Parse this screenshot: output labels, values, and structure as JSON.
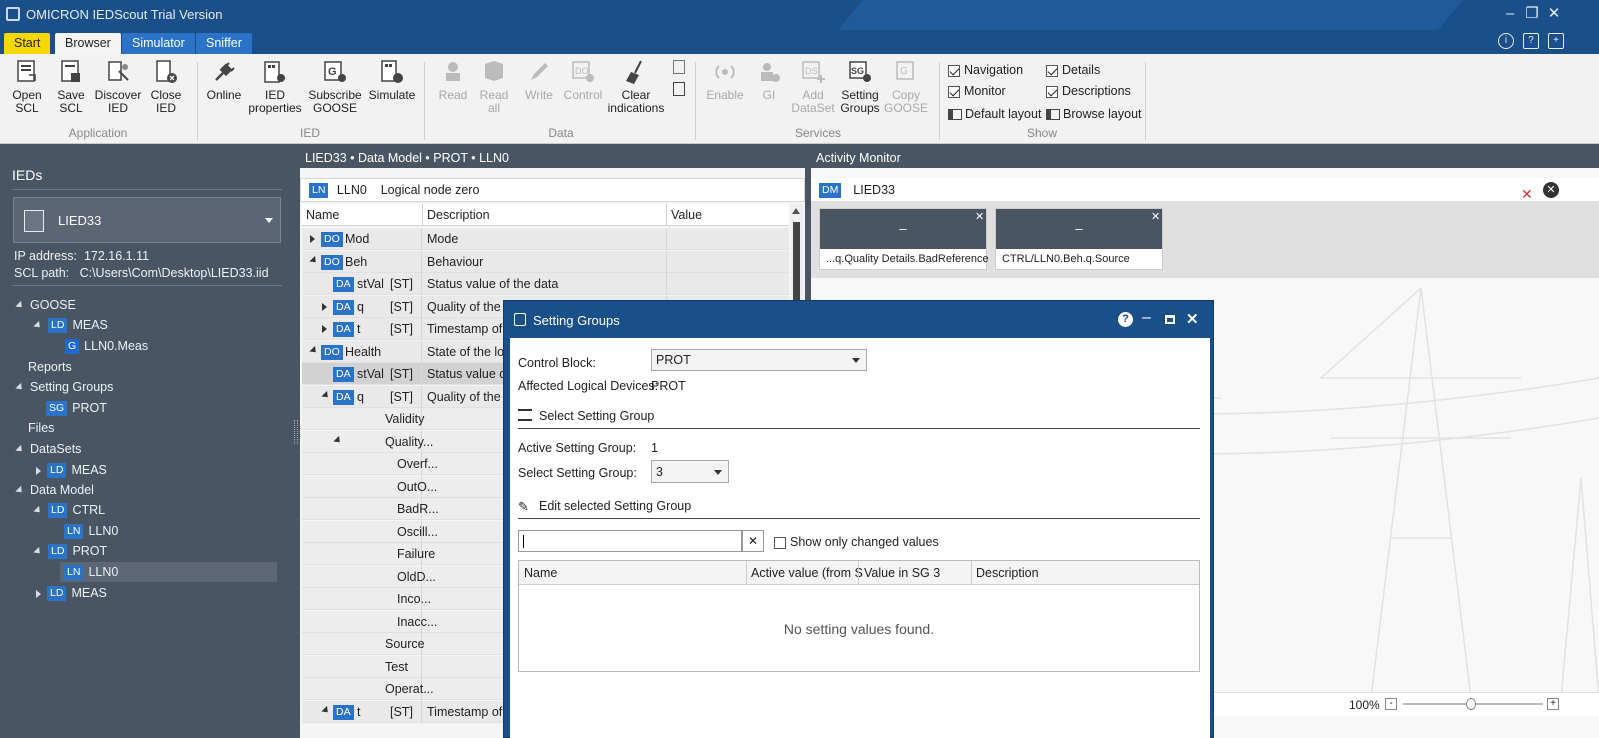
{
  "app": {
    "title": "OMICRON IEDScout Trial Version"
  },
  "tabs": [
    "Start",
    "Browser",
    "Simulator",
    "Sniffer"
  ],
  "ribbon": {
    "application": {
      "group_label": "Application",
      "open_scl": "Open\nSCL",
      "save_scl": "Save\nSCL",
      "discover_ied": "Discover\nIED",
      "close_ied": "Close\nIED"
    },
    "ied": {
      "group_label": "IED",
      "online": "Online",
      "ied_properties": "IED\nproperties",
      "subscribe_goose": "Subscribe\nGOOSE",
      "simulate": "Simulate"
    },
    "data": {
      "group_label": "Data",
      "read": "Read",
      "read_all": "Read\nall",
      "write": "Write",
      "control": "Control",
      "clear_indications": "Clear\nindications"
    },
    "services": {
      "group_label": "Services",
      "enable": "Enable",
      "gi": "GI",
      "add_dataset": "Add\nDataSet",
      "setting_groups": "Setting\nGroups",
      "copy_goose": "Copy\nGOOSE"
    },
    "show": {
      "group_label": "Show",
      "navigation": "Navigation",
      "details": "Details",
      "monitor": "Monitor",
      "descriptions": "Descriptions",
      "default_layout": "Default layout",
      "browse_layout": "Browse layout"
    }
  },
  "left": {
    "title": "IEDs",
    "ied_name": "LIED33",
    "ip_label": "IP address:",
    "ip_value": "172.16.1.11",
    "scl_label": "SCL path:",
    "scl_value": "C:\\Users\\Com\\Desktop\\LIED33.iid",
    "tree": {
      "goose": "GOOSE",
      "goose_ld": "MEAS",
      "goose_cb": "LLN0.Meas",
      "reports": "Reports",
      "setting_groups": "Setting Groups",
      "sg_prot": "PROT",
      "files": "Files",
      "datasets": "DataSets",
      "ds_meas": "MEAS",
      "data_model": "Data Model",
      "dm_ctrl": "CTRL",
      "dm_ctrl_lln0": "LLN0",
      "dm_prot": "PROT",
      "dm_prot_lln0": "LLN0",
      "dm_meas": "MEAS"
    },
    "badges": {
      "ld": "LD",
      "ln": "LN",
      "sg": "SG",
      "g": "G"
    }
  },
  "mid": {
    "header": "LIED33 • Data Model • PROT • LLN0",
    "ln_badge": "LN",
    "ln_name": "LLN0",
    "ln_desc": "Logical node zero",
    "col_name": "Name",
    "col_desc": "Description",
    "col_value": "Value",
    "rows": [
      {
        "badge": "DO",
        "name": "Mod",
        "fc": "",
        "desc": "Mode"
      },
      {
        "badge": "DO",
        "name": "Beh",
        "fc": "",
        "desc": "Behaviour"
      },
      {
        "badge": "DA",
        "name": "stVal",
        "fc": "[ST]",
        "desc": "Status value of the data"
      },
      {
        "badge": "DA",
        "name": "q",
        "fc": "[ST]",
        "desc": "Quality of the"
      },
      {
        "badge": "DA",
        "name": "t",
        "fc": "[ST]",
        "desc": "Timestamp of"
      },
      {
        "badge": "DO",
        "name": "Health",
        "fc": "",
        "desc": "State of the lo"
      },
      {
        "badge": "DA",
        "name": "stVal",
        "fc": "[ST]",
        "desc": "Status value o"
      },
      {
        "badge": "DA",
        "name": "q",
        "fc": "[ST]",
        "desc": "Quality of the"
      },
      {
        "badge": "",
        "name": "Validity",
        "fc": "",
        "desc": ""
      },
      {
        "badge": "",
        "name": "Quality...",
        "fc": "",
        "desc": ""
      },
      {
        "badge": "",
        "name": "Overf...",
        "fc": "",
        "desc": ""
      },
      {
        "badge": "",
        "name": "OutO...",
        "fc": "",
        "desc": ""
      },
      {
        "badge": "",
        "name": "BadR...",
        "fc": "",
        "desc": ""
      },
      {
        "badge": "",
        "name": "Oscill...",
        "fc": "",
        "desc": ""
      },
      {
        "badge": "",
        "name": "Failure",
        "fc": "",
        "desc": ""
      },
      {
        "badge": "",
        "name": "OldD...",
        "fc": "",
        "desc": ""
      },
      {
        "badge": "",
        "name": "Inco...",
        "fc": "",
        "desc": ""
      },
      {
        "badge": "",
        "name": "Inacc...",
        "fc": "",
        "desc": ""
      },
      {
        "badge": "",
        "name": "Source",
        "fc": "",
        "desc": ""
      },
      {
        "badge": "",
        "name": "Test",
        "fc": "",
        "desc": ""
      },
      {
        "badge": "",
        "name": "Operat...",
        "fc": "",
        "desc": ""
      },
      {
        "badge": "DA",
        "name": "t",
        "fc": "[ST]",
        "desc": "Timestamp of"
      }
    ]
  },
  "activity": {
    "header": "Activity Monitor",
    "dm_badge": "DM",
    "ied_name": "LIED33",
    "cards": [
      {
        "value": "–",
        "label": "...q.Quality Details.BadReference"
      },
      {
        "value": "–",
        "label": "CTRL/LLN0.Beh.q.Source"
      }
    ],
    "zoom": "100%"
  },
  "dialog": {
    "title": "Setting Groups",
    "control_block_label": "Control Block:",
    "control_block_value": "PROT",
    "affected_label": "Affected Logical Devices:",
    "affected_value": "PROT",
    "select_section": "Select Setting Group",
    "active_label": "Active Setting Group:",
    "active_value": "1",
    "select_label": "Select Setting Group:",
    "select_value": "3",
    "edit_section": "Edit selected Setting Group",
    "search_value": "",
    "show_changed": "Show only changed values",
    "columns": [
      "Name",
      "Active value (from S",
      "Value in SG 3",
      "Description"
    ],
    "empty": "No setting values found."
  }
}
